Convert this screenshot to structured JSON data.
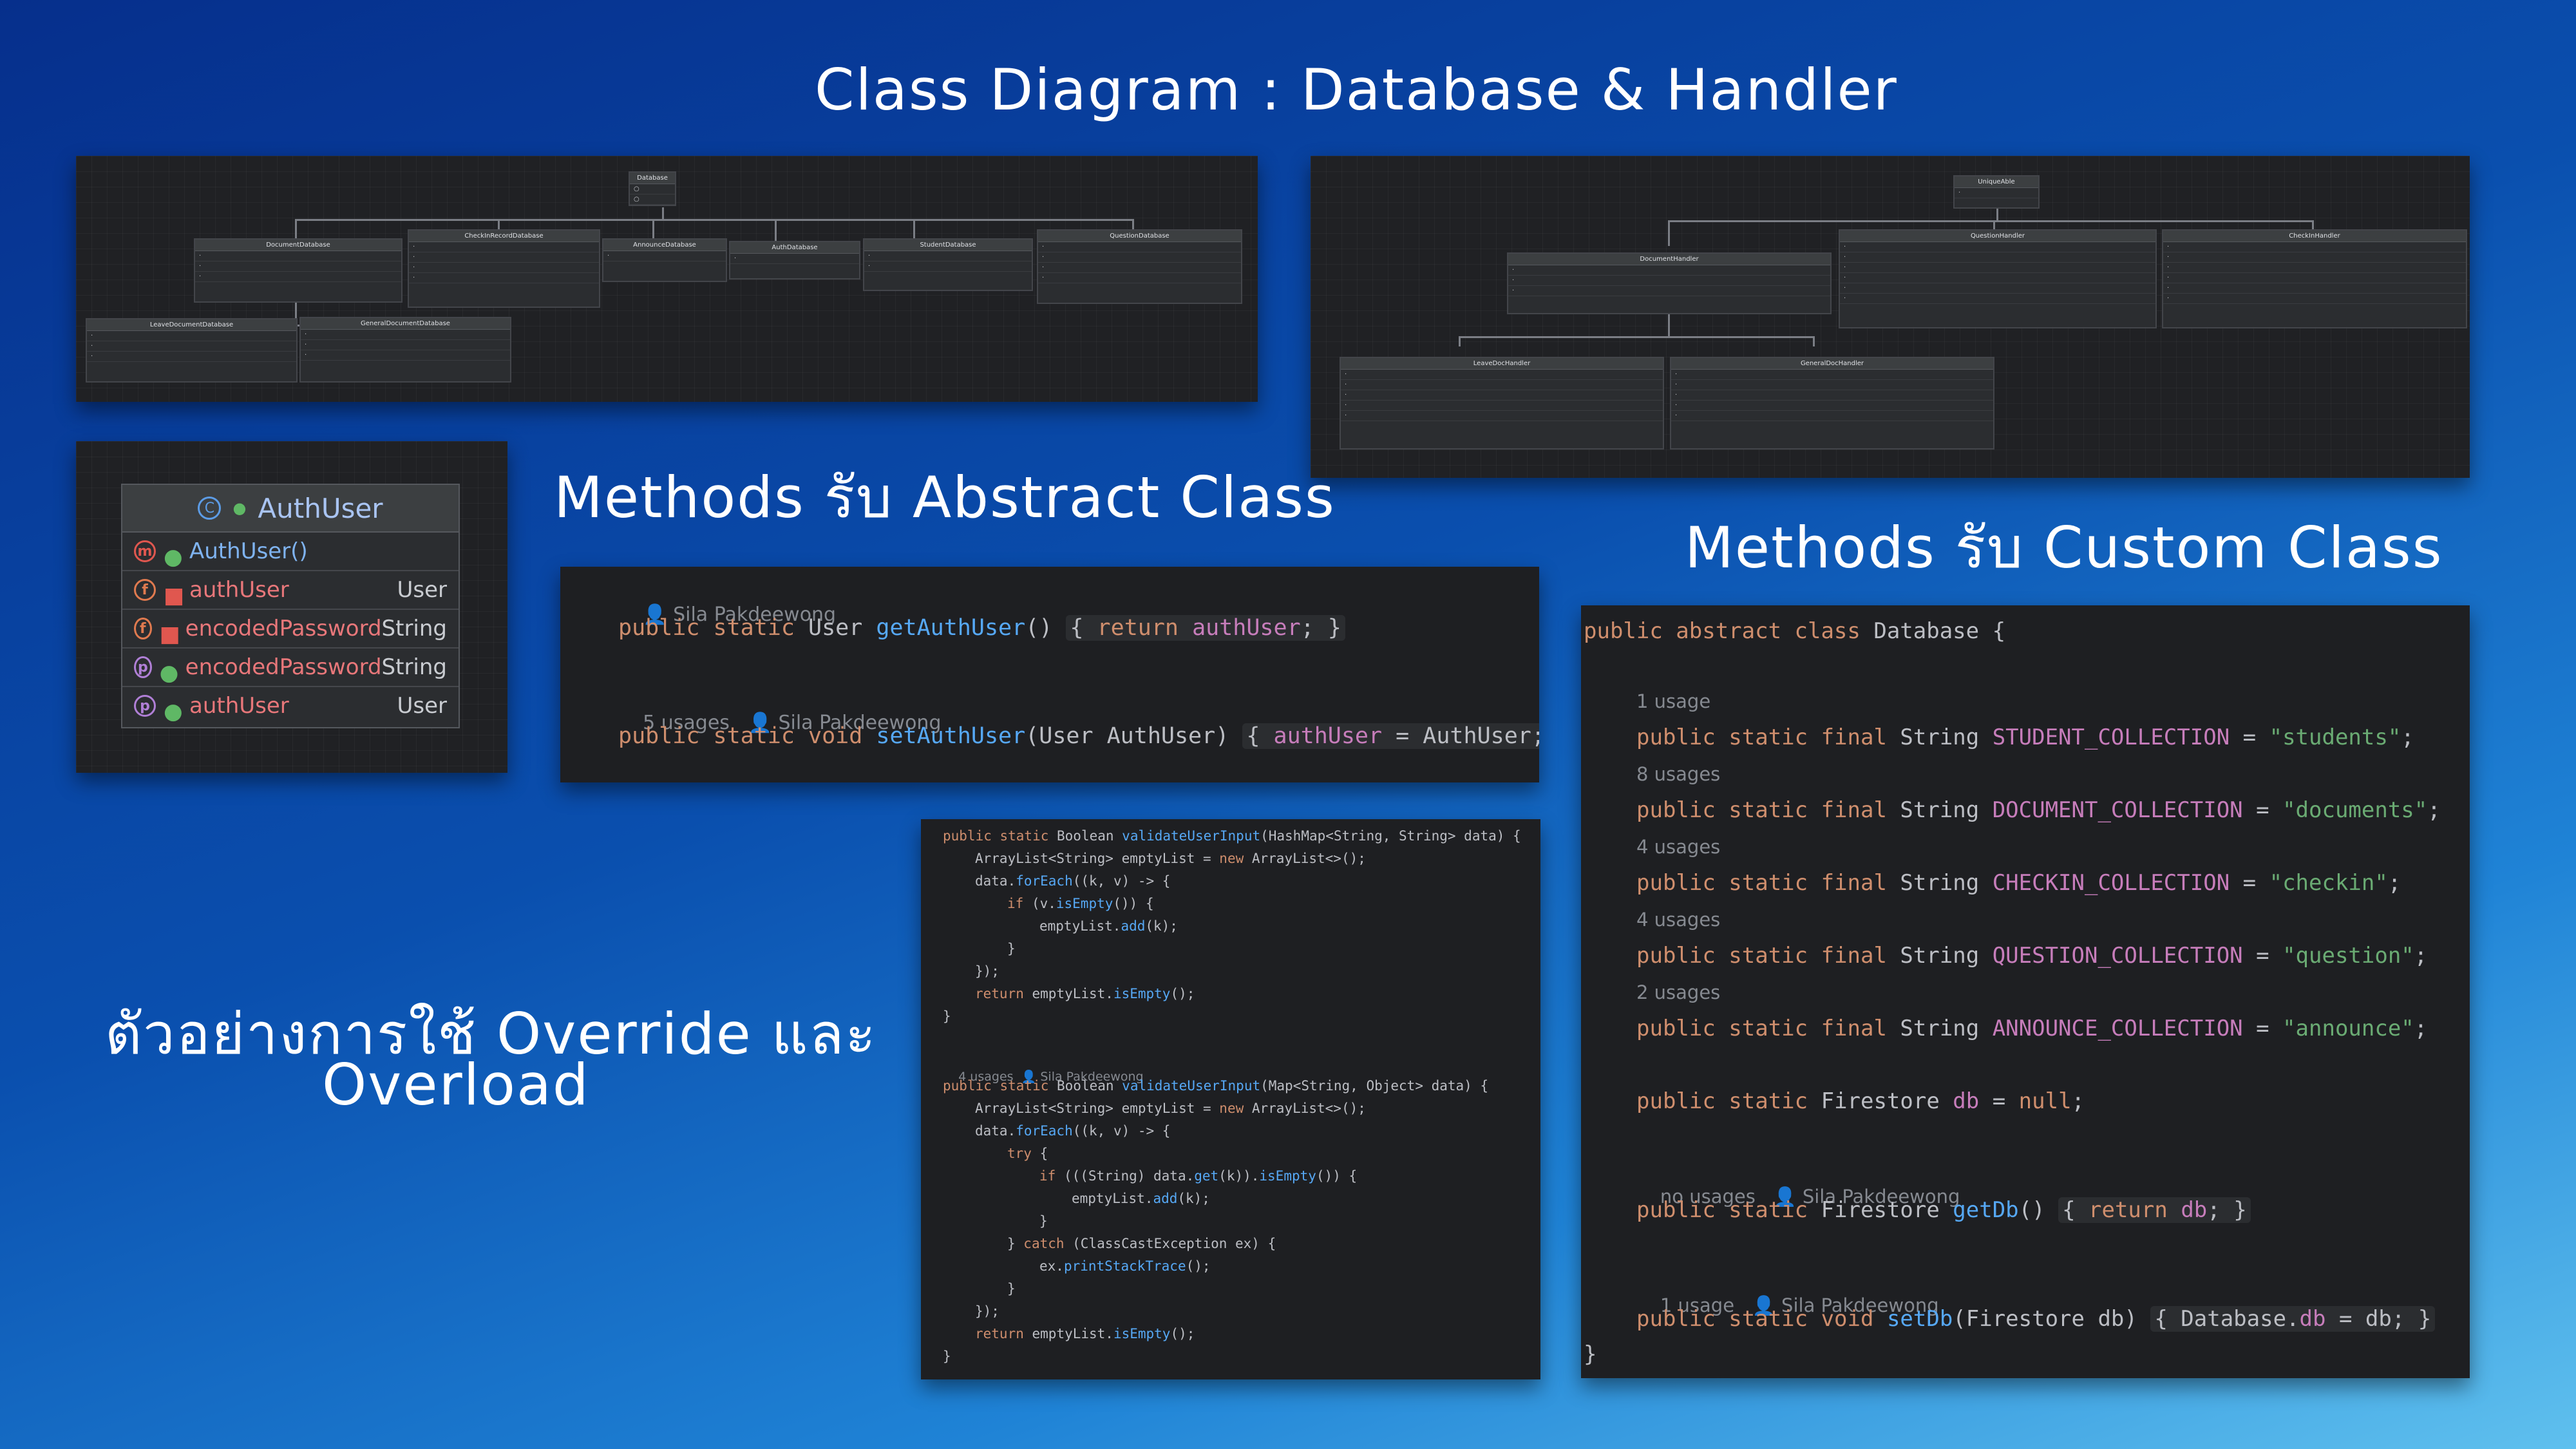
{
  "title": "Class Diagram : Database & Handler",
  "captions": {
    "abstract": "Methods รับ Abstract Class",
    "custom": "Methods รับ Custom Class",
    "override_line1": "ตัวอย่างการใช้ Override และ",
    "override_line2": "Overload"
  },
  "auth_card": {
    "title": "AuthUser",
    "rows": [
      {
        "badge": "m",
        "name": "AuthUser()",
        "type": ""
      },
      {
        "badge": "f",
        "name": "authUser",
        "type": "User"
      },
      {
        "badge": "f",
        "name": "encodedPassword",
        "type": "String"
      },
      {
        "badge": "p",
        "name": "encodedPassword",
        "type": "String"
      },
      {
        "badge": "p",
        "name": "authUser",
        "type": "User"
      }
    ]
  },
  "auth_code": {
    "author1": "Sila Pakdeewong",
    "usages2": "5 usages",
    "author2": "Sila Pakdeewong"
  },
  "db_code": {
    "usage1": "1 usage",
    "usage2": "8 usages",
    "usage3": "4 usages",
    "usage4": "4 usages",
    "usage5": "2 usages",
    "usage6": "no usages",
    "author6": "Sila Pakdeewong",
    "usage7": "1 usage",
    "author7": "Sila Pakdeewong"
  },
  "validate_code": {
    "usages": "4 usages",
    "author": "Sila Pakdeewong"
  },
  "diagram_left": {
    "root": "Database",
    "children": [
      "DocumentDatabase",
      "CheckInRecordDatabase",
      "AnnounceDatabase",
      "AuthDatabase",
      "StudentDatabase",
      "QuestionDatabase"
    ],
    "grandchildren": [
      "LeaveDocumentDatabase",
      "GeneralDocumentDatabase"
    ]
  },
  "diagram_right": {
    "root": "UniqueAble",
    "children": [
      "DocumentHandler",
      "QuestionHandler",
      "CheckInHandler"
    ],
    "grandchildren": [
      "LeaveDocHandler",
      "GeneralDocHandler"
    ]
  }
}
